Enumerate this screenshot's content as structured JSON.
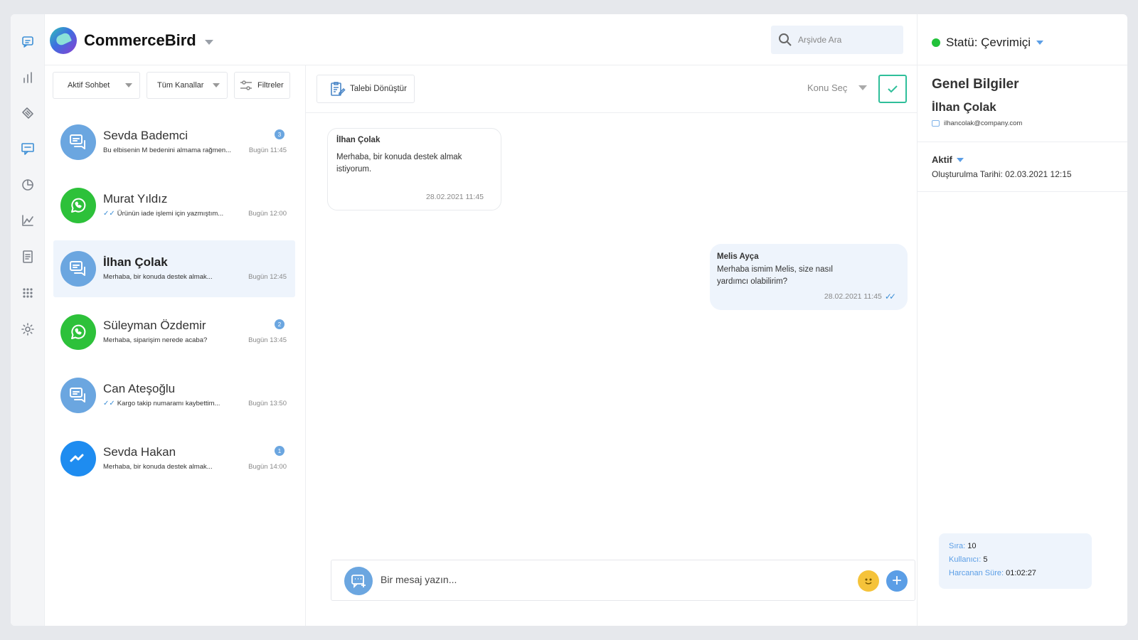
{
  "app": {
    "brand": "CommerceBird"
  },
  "search": {
    "placeholder": "Arşivde Ara"
  },
  "rail": {
    "icons": [
      "chat-icon",
      "bar-chart-icon",
      "ticket-icon",
      "message-icon",
      "pie-chart-icon",
      "line-chart-icon",
      "document-icon",
      "apps-grid-icon",
      "gear-icon"
    ],
    "active_color": "#3d8fd6"
  },
  "filters": {
    "active_chat": "Aktif Sohbet",
    "all_channels": "Tüm Kanallar",
    "filters_label": "Filtreler"
  },
  "conversations": [
    {
      "name": "Sevda Bademci",
      "preview": "Bu elbisenin M bedenini almama rağmen...",
      "time": "Bugün 11:45",
      "badge": "3",
      "channel": "chat",
      "read_tick": false
    },
    {
      "name": "Murat Yıldız",
      "preview": "Ürünün iade işlemi için yazmıştım...",
      "time": "Bugün 12:00",
      "badge": "",
      "channel": "whatsapp",
      "read_tick": true
    },
    {
      "name": "İlhan Çolak",
      "preview": "Merhaba, bir konuda destek almak...",
      "time": "Bugün  12:45",
      "badge": "",
      "channel": "chat",
      "read_tick": false,
      "selected": true
    },
    {
      "name": "Süleyman Özdemir",
      "preview": "Merhaba, siparişim nerede acaba?",
      "time": "Bugün 13:45",
      "badge": "2",
      "channel": "whatsapp",
      "read_tick": false
    },
    {
      "name": "Can Ateşoğlu",
      "preview": "Kargo takip numaramı kaybettim...",
      "time": "Bugün 13:50",
      "badge": "",
      "channel": "chat",
      "read_tick": true
    },
    {
      "name": "Sevda Hakan",
      "preview": "Merhaba, bir konuda destek almak...",
      "time": "Bugün 14:00",
      "badge": "1",
      "channel": "messenger",
      "read_tick": false
    }
  ],
  "chat": {
    "convert_label": "Talebi Dönüştür",
    "topic_label": "Konu Seç",
    "messages": [
      {
        "sender": "İlhan Çolak",
        "text": "Merhaba, bir konuda destek almak istiyorum.",
        "time": "28.02.2021 11:45",
        "direction": "in"
      },
      {
        "sender": "Melis Ayça",
        "text": "Merhaba ismim Melis, size nasıl yardımcı olabilirim?",
        "time": "28.02.2021 11:45",
        "direction": "out"
      }
    ],
    "composer_placeholder": "Bir mesaj yazın..."
  },
  "panel": {
    "status": "Statü: Çevrimiçi",
    "status_color": "#22c23a",
    "title": "Genel Bilgiler",
    "customer_name": "İlhan Çolak",
    "email": "ilhancolak@company.com",
    "state": "Aktif",
    "created": "Oluşturulma Tarihi: 02.03.2021 12:15",
    "stats": {
      "queue_label": "Sıra:",
      "queue_value": "10",
      "user_label": "Kullanıcı:",
      "user_value": "5",
      "time_label": "Harcanan Süre:",
      "time_value": "01:02:27"
    }
  }
}
